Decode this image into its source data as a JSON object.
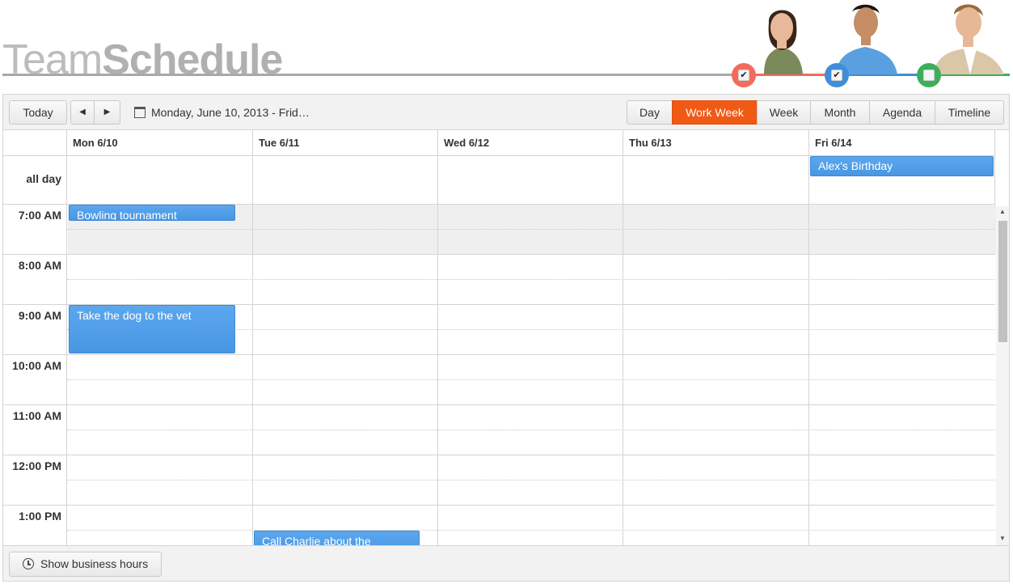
{
  "header": {
    "title_light": "Team",
    "title_bold": "Schedule",
    "team": [
      {
        "color": "#f26b5b",
        "checked": true,
        "check": "✔"
      },
      {
        "color": "#3e8ed8",
        "checked": true,
        "check": "✔"
      },
      {
        "color": "#3fae5c",
        "checked": false,
        "check": ""
      }
    ]
  },
  "toolbar": {
    "today_label": "Today",
    "prev_icon": "◀",
    "next_icon": "▶",
    "date_range": "Monday, June 10, 2013 - Frid…",
    "views": [
      {
        "label": "Day",
        "active": false
      },
      {
        "label": "Work Week",
        "active": true
      },
      {
        "label": "Week",
        "active": false
      },
      {
        "label": "Month",
        "active": false
      },
      {
        "label": "Agenda",
        "active": false
      },
      {
        "label": "Timeline",
        "active": false
      }
    ]
  },
  "grid": {
    "days": [
      "Mon 6/10",
      "Tue 6/11",
      "Wed 6/12",
      "Thu 6/13",
      "Fri 6/14"
    ],
    "allday_label": "all day",
    "times": [
      "7:00 AM",
      "8:00 AM",
      "9:00 AM",
      "10:00 AM",
      "11:00 AM",
      "12:00 PM",
      "1:00 PM"
    ],
    "allday_events": [
      {
        "title": "Alex's Birthday"
      }
    ],
    "events": [
      {
        "title": "Bowling tournament"
      },
      {
        "title": "Take the dog to the vet"
      },
      {
        "title": "Call Charlie about the"
      }
    ]
  },
  "footer": {
    "business_hours_label": "Show business hours"
  },
  "colors": {
    "accent": "#f05a14",
    "event": "#4a98e6"
  }
}
